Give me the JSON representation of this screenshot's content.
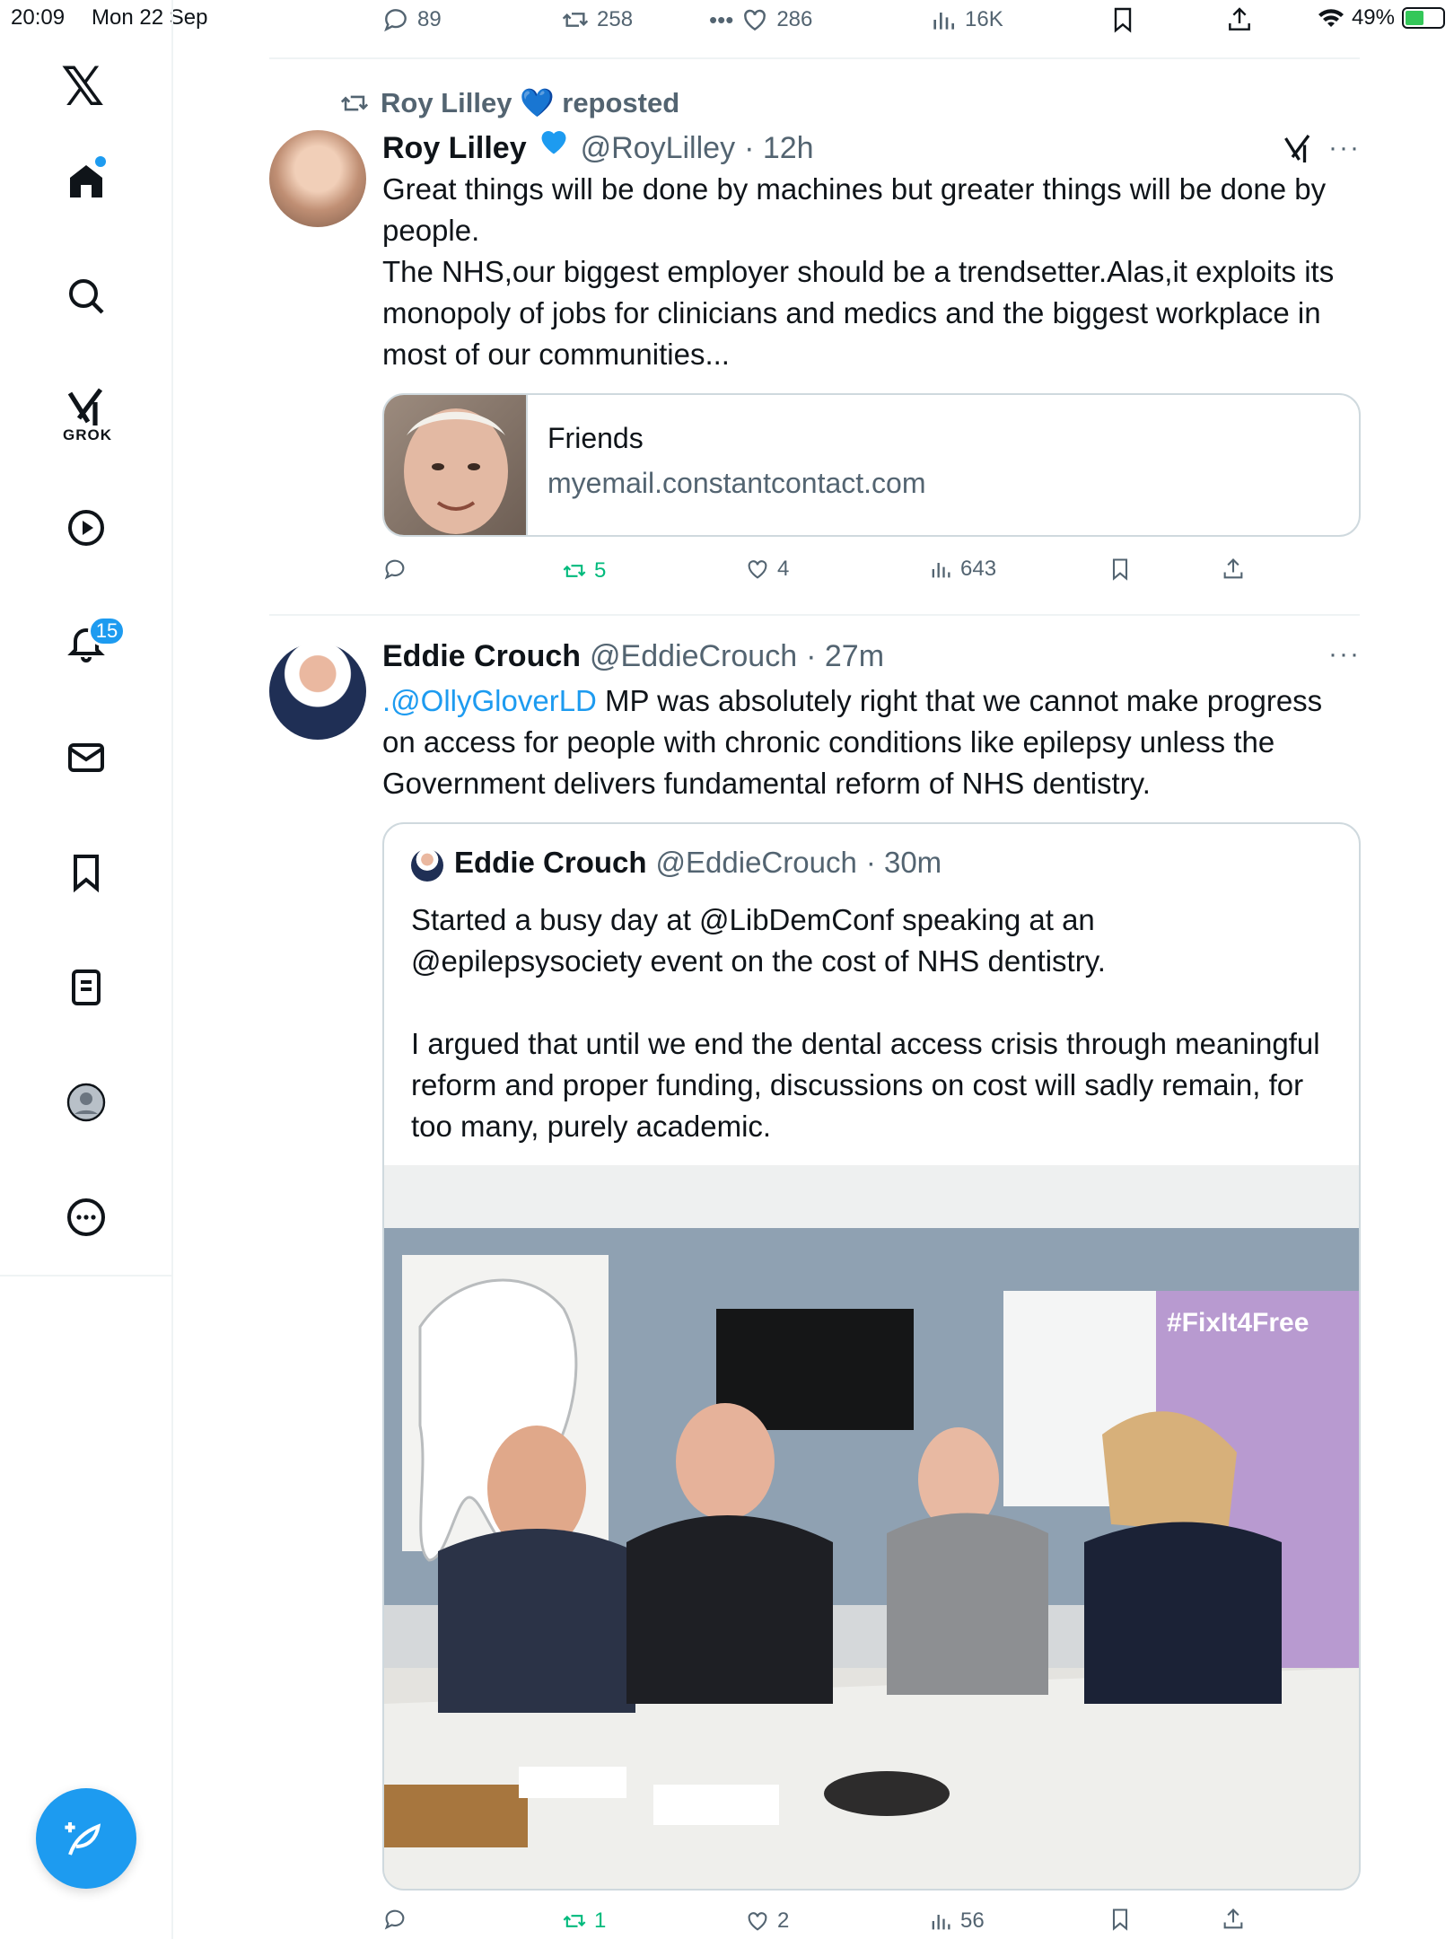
{
  "status_bar": {
    "time": "20:09",
    "date": "Mon 22 Sep",
    "battery": "49%",
    "battery_level": 0.49
  },
  "prev_tweet_actions": {
    "replies": "89",
    "reposts": "258",
    "likes": "286",
    "views": "16K"
  },
  "sidebar": {
    "items": [
      {
        "name": "home",
        "icon": "home-icon"
      },
      {
        "name": "search",
        "icon": "search-icon"
      },
      {
        "name": "grok",
        "icon": "grok-icon",
        "label": "GROK"
      },
      {
        "name": "video",
        "icon": "play-icon"
      },
      {
        "name": "notifications",
        "icon": "bell-icon",
        "badge": "15"
      },
      {
        "name": "messages",
        "icon": "mail-icon"
      },
      {
        "name": "bookmarks",
        "icon": "bookmark-icon"
      },
      {
        "name": "lists",
        "icon": "list-icon"
      },
      {
        "name": "profile",
        "icon": "profile-icon"
      },
      {
        "name": "more",
        "icon": "more-icon"
      }
    ],
    "compose_icon": "compose-icon"
  },
  "tweet1": {
    "repost_banner": "Roy Lilley 💙 reposted",
    "name": "Roy Lilley",
    "handle": "@RoyLilley",
    "time": "· 12h",
    "text": "Great things will be done by machines but greater things will be done by people.\nThe NHS,our biggest employer should be a trendsetter.Alas,it exploits its monopoly of jobs for clinicians and medics and the biggest workplace in most of our communities...",
    "card": {
      "title": "Friends",
      "domain": "myemail.constantcontact.com"
    },
    "actions": {
      "replies": "",
      "reposts": "5",
      "likes": "4",
      "views": "643"
    }
  },
  "tweet2": {
    "name": "Eddie Crouch",
    "handle": "@EddieCrouch",
    "time": "· 27m",
    "mention": ".@OllyGloverLD",
    "text_rest": " MP was absolutely right that we cannot make progress on access for people with chronic conditions like epilepsy unless the Government delivers fundamental reform of NHS dentistry.",
    "quote": {
      "name": "Eddie Crouch",
      "handle": "@EddieCrouch",
      "time": "· 30m",
      "text": "Started a busy day at @LibDemConf speaking at an @epilepsysociety event on the cost of NHS dentistry.\n\nI argued that until we end the dental access crisis through meaningful reform and proper funding, discussions on cost will sadly remain, for too many, purely academic.",
      "photo_banner": "#FixIt4Free"
    },
    "actions": {
      "replies": "",
      "reposts": "1",
      "likes": "2",
      "views": "56"
    }
  }
}
